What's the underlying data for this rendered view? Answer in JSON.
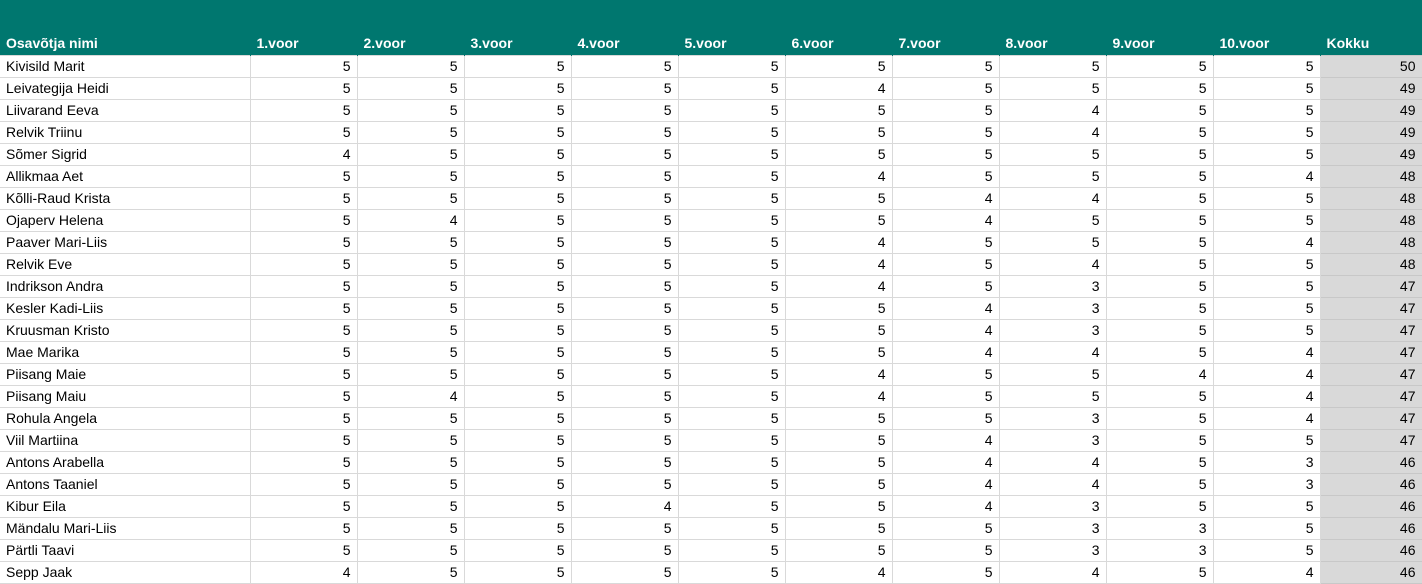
{
  "headers": {
    "name": "Osavõtja nimi",
    "rounds": [
      "1.voor",
      "2.voor",
      "3.voor",
      "4.voor",
      "5.voor",
      "6.voor",
      "7.voor",
      "8.voor",
      "9.voor",
      "10.voor"
    ],
    "total": "Kokku"
  },
  "rows": [
    {
      "name": "Kivisild Marit",
      "r": [
        5,
        5,
        5,
        5,
        5,
        5,
        5,
        5,
        5,
        5
      ],
      "t": 50
    },
    {
      "name": "Leivategija Heidi",
      "r": [
        5,
        5,
        5,
        5,
        5,
        4,
        5,
        5,
        5,
        5
      ],
      "t": 49
    },
    {
      "name": "Liivarand Eeva",
      "r": [
        5,
        5,
        5,
        5,
        5,
        5,
        5,
        4,
        5,
        5
      ],
      "t": 49
    },
    {
      "name": "Relvik Triinu",
      "r": [
        5,
        5,
        5,
        5,
        5,
        5,
        5,
        4,
        5,
        5
      ],
      "t": 49
    },
    {
      "name": "Sõmer Sigrid",
      "r": [
        4,
        5,
        5,
        5,
        5,
        5,
        5,
        5,
        5,
        5
      ],
      "t": 49
    },
    {
      "name": "Allikmaa Aet",
      "r": [
        5,
        5,
        5,
        5,
        5,
        4,
        5,
        5,
        5,
        4
      ],
      "t": 48
    },
    {
      "name": "Kõlli-Raud Krista",
      "r": [
        5,
        5,
        5,
        5,
        5,
        5,
        4,
        4,
        5,
        5
      ],
      "t": 48
    },
    {
      "name": "Ojaperv Helena",
      "r": [
        5,
        4,
        5,
        5,
        5,
        5,
        4,
        5,
        5,
        5
      ],
      "t": 48
    },
    {
      "name": "Paaver Mari-Liis",
      "r": [
        5,
        5,
        5,
        5,
        5,
        4,
        5,
        5,
        5,
        4
      ],
      "t": 48
    },
    {
      "name": "Relvik Eve",
      "r": [
        5,
        5,
        5,
        5,
        5,
        4,
        5,
        4,
        5,
        5
      ],
      "t": 48
    },
    {
      "name": "Indrikson Andra",
      "r": [
        5,
        5,
        5,
        5,
        5,
        4,
        5,
        3,
        5,
        5
      ],
      "t": 47
    },
    {
      "name": "Kesler Kadi-Liis",
      "r": [
        5,
        5,
        5,
        5,
        5,
        5,
        4,
        3,
        5,
        5
      ],
      "t": 47
    },
    {
      "name": "Kruusman Kristo",
      "r": [
        5,
        5,
        5,
        5,
        5,
        5,
        4,
        3,
        5,
        5
      ],
      "t": 47
    },
    {
      "name": "Mae Marika",
      "r": [
        5,
        5,
        5,
        5,
        5,
        5,
        4,
        4,
        5,
        4
      ],
      "t": 47
    },
    {
      "name": "Piisang Maie",
      "r": [
        5,
        5,
        5,
        5,
        5,
        4,
        5,
        5,
        4,
        4
      ],
      "t": 47
    },
    {
      "name": "Piisang Maiu",
      "r": [
        5,
        4,
        5,
        5,
        5,
        4,
        5,
        5,
        5,
        4
      ],
      "t": 47
    },
    {
      "name": "Rohula Angela",
      "r": [
        5,
        5,
        5,
        5,
        5,
        5,
        5,
        3,
        5,
        4
      ],
      "t": 47
    },
    {
      "name": "Viil Martiina",
      "r": [
        5,
        5,
        5,
        5,
        5,
        5,
        4,
        3,
        5,
        5
      ],
      "t": 47
    },
    {
      "name": "Antons Arabella",
      "r": [
        5,
        5,
        5,
        5,
        5,
        5,
        4,
        4,
        5,
        3
      ],
      "t": 46
    },
    {
      "name": "Antons Taaniel",
      "r": [
        5,
        5,
        5,
        5,
        5,
        5,
        4,
        4,
        5,
        3
      ],
      "t": 46
    },
    {
      "name": "Kibur Eila",
      "r": [
        5,
        5,
        5,
        4,
        5,
        5,
        4,
        3,
        5,
        5
      ],
      "t": 46
    },
    {
      "name": "Mändalu Mari-Liis",
      "r": [
        5,
        5,
        5,
        5,
        5,
        5,
        5,
        3,
        3,
        5
      ],
      "t": 46
    },
    {
      "name": "Pärtli Taavi",
      "r": [
        5,
        5,
        5,
        5,
        5,
        5,
        5,
        3,
        3,
        5
      ],
      "t": 46
    },
    {
      "name": "Sepp Jaak",
      "r": [
        4,
        5,
        5,
        5,
        5,
        4,
        5,
        4,
        5,
        4
      ],
      "t": 46
    }
  ]
}
